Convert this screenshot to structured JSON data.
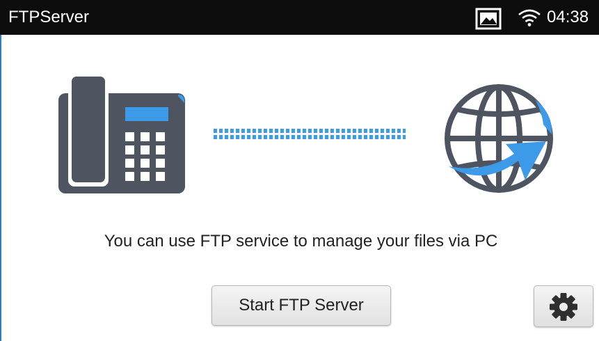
{
  "status_bar": {
    "app_title": "FTPServer",
    "time": "04:38",
    "icons": [
      "gallery-icon",
      "wifi-icon"
    ]
  },
  "main": {
    "illustration_icons": [
      "desk-phone-icon",
      "dotted-connection",
      "globe-icon"
    ],
    "description": "You can use FTP service to manage your files via PC",
    "start_button_label": "Start FTP Server",
    "settings_icon": "gear-icon"
  },
  "colors": {
    "status_bar_bg": "#0d0d0d",
    "phone_body": "#4f5560",
    "accent_blue": "#3d9ae8",
    "globe": "#4f5560"
  }
}
